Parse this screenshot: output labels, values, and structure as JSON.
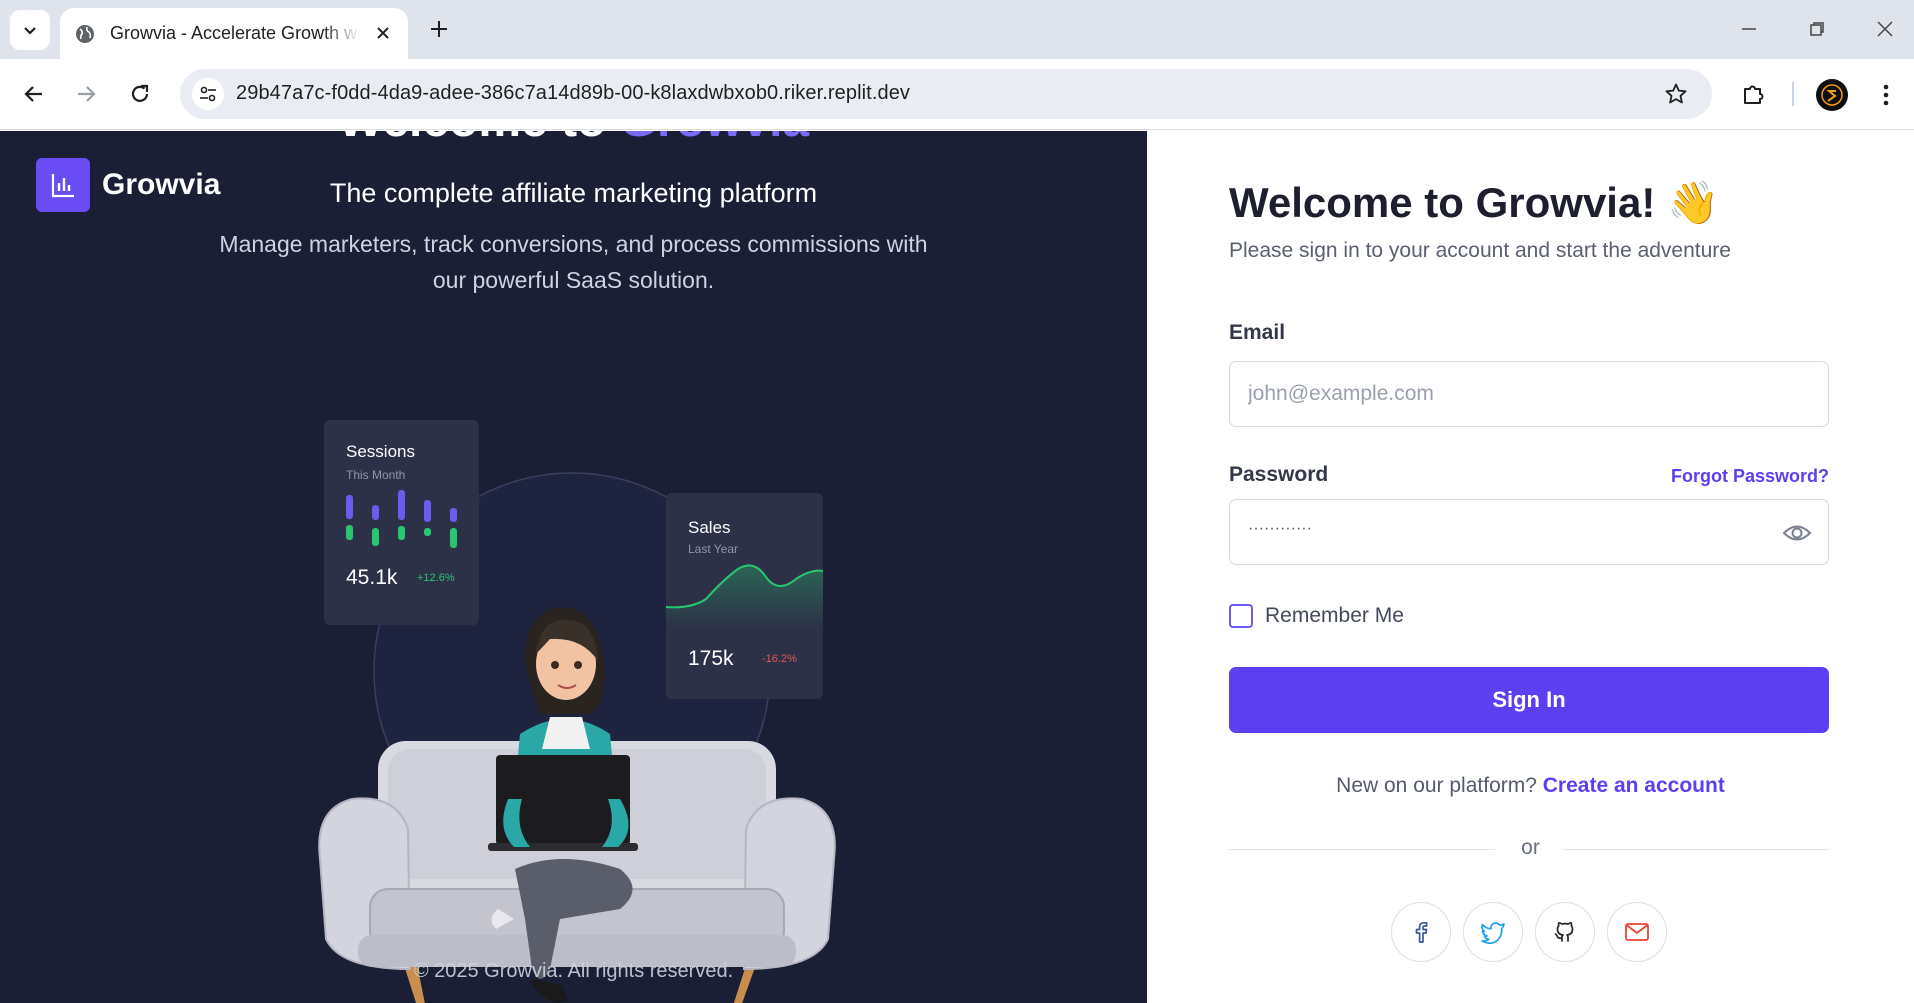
{
  "browser": {
    "tab_title": "Growvia - Accelerate Growth with Affiliate Marketing",
    "url": "29b47a7c-f0dd-4da9-adee-386c7a14d89b-00-k8laxdwbxob0.riker.replit.dev"
  },
  "hero": {
    "cut_title_prefix": "Welcome to ",
    "cut_title_accent": "Growvia",
    "brand": "Growvia",
    "subtitle": "The complete affiliate marketing platform",
    "description": "Manage marketers, track conversions, and process commissions with our powerful SaaS solution.",
    "sessions_card": {
      "title": "Sessions",
      "subtitle": "This Month",
      "value": "45.1k",
      "change": "+12.6%"
    },
    "sales_card": {
      "title": "Sales",
      "subtitle": "Last Year",
      "value": "175k",
      "change": "-16.2%"
    },
    "footer": "© 2025 Growvia. All rights reserved."
  },
  "login": {
    "title": "Welcome to Growvia!",
    "title_emoji": "👋",
    "subtitle": "Please sign in to your account and start the adventure",
    "email_label": "Email",
    "email_placeholder": "john@example.com",
    "password_label": "Password",
    "password_value": "············",
    "forgot": "Forgot Password?",
    "remember": "Remember Me",
    "signin": "Sign In",
    "new_prefix": "New on our platform?",
    "new_link": "Create an account",
    "or": "or",
    "social_icons": [
      "facebook-icon",
      "twitter-icon",
      "github-icon",
      "mail-icon"
    ]
  },
  "colors": {
    "accent": "#5b3ff0",
    "hero_bg": "#1a1f36",
    "card_bg": "#2c3147",
    "positive": "#28c76f",
    "negative": "#ea5455"
  }
}
